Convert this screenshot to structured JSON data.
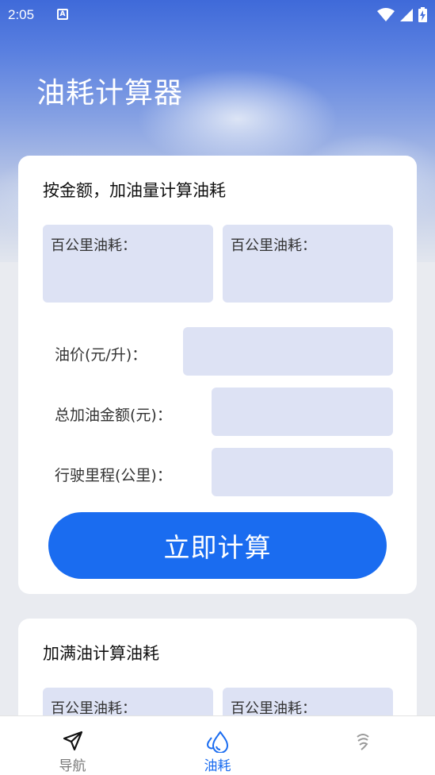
{
  "status_bar": {
    "time": "2:05",
    "notification_icon": "a-letter-icon",
    "icons": [
      "wifi-icon",
      "signal-icon",
      "battery-charging-icon"
    ]
  },
  "app": {
    "title": "油耗计算器"
  },
  "section1": {
    "title": "按金额，加油量计算油耗",
    "result_left_label": "百公里油耗：",
    "result_right_label": "百公里油耗：",
    "fields": [
      {
        "label": "油价(元/升)：",
        "value": ""
      },
      {
        "label": "总加油金额(元)：",
        "value": ""
      },
      {
        "label": "行驶里程(公里)：",
        "value": ""
      }
    ],
    "calc_button": "立即计算"
  },
  "section2": {
    "title": "加满油计算油耗",
    "result_left_label": "百公里油耗：",
    "result_right_label": "百公里油耗："
  },
  "bottom_nav": {
    "items": [
      {
        "label": "导航",
        "icon": "navigation-arrow-icon",
        "active": false
      },
      {
        "label": "油耗",
        "icon": "water-drop-icon",
        "active": true
      },
      {
        "label": "",
        "icon": "gesture-icon",
        "active": false
      }
    ]
  },
  "colors": {
    "accent": "#1a6cf0",
    "field_bg": "#dde2f4",
    "inactive_nav": "#777777"
  }
}
